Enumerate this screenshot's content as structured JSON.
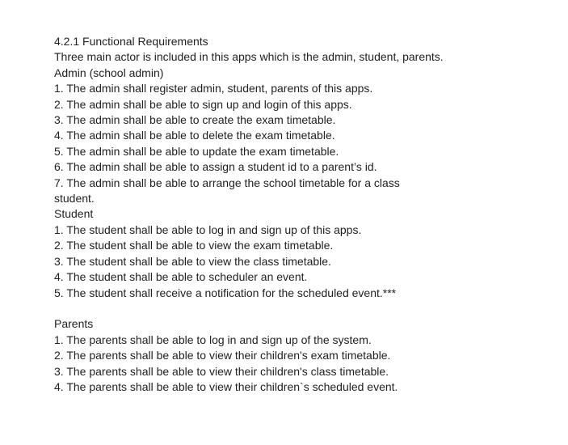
{
  "document": {
    "heading": "4.2.1 Functional Requirements",
    "intro": "Three main actor is included in this apps which is the admin, student, parents.",
    "admin": {
      "title": "Admin (school admin)",
      "items": [
        "1. The admin shall register admin, student, parents of this apps.",
        "2. The admin shall be able to sign up and login of this apps.",
        "3. The admin shall be able to create the exam timetable.",
        "4. The admin shall be able to delete the exam timetable.",
        "5. The admin shall be able to update the exam timetable.",
        "6. The admin shall be able to assign a student id to a parent’s id.",
        "7. The admin shall be able to arrange the school timetable for a class",
        "student."
      ]
    },
    "student": {
      "title": "Student",
      "items": [
        "1. The student shall be able to log in and sign up of this apps.",
        "2. The student shall be able to view the exam timetable.",
        "3. The student shall be able to view the class timetable.",
        "4. The student shall be able to scheduler an event.",
        "5. The student shall receive a notification for the scheduled event.***"
      ]
    },
    "parents": {
      "title": "Parents",
      "items": [
        "1. The parents shall be able to log in and sign up of the system.",
        "2. The parents shall be able to view their children's exam timetable.",
        "3. The parents shall be able to view their children's class timetable.",
        "4. The parents shall be able to view their children`s scheduled event."
      ]
    }
  }
}
